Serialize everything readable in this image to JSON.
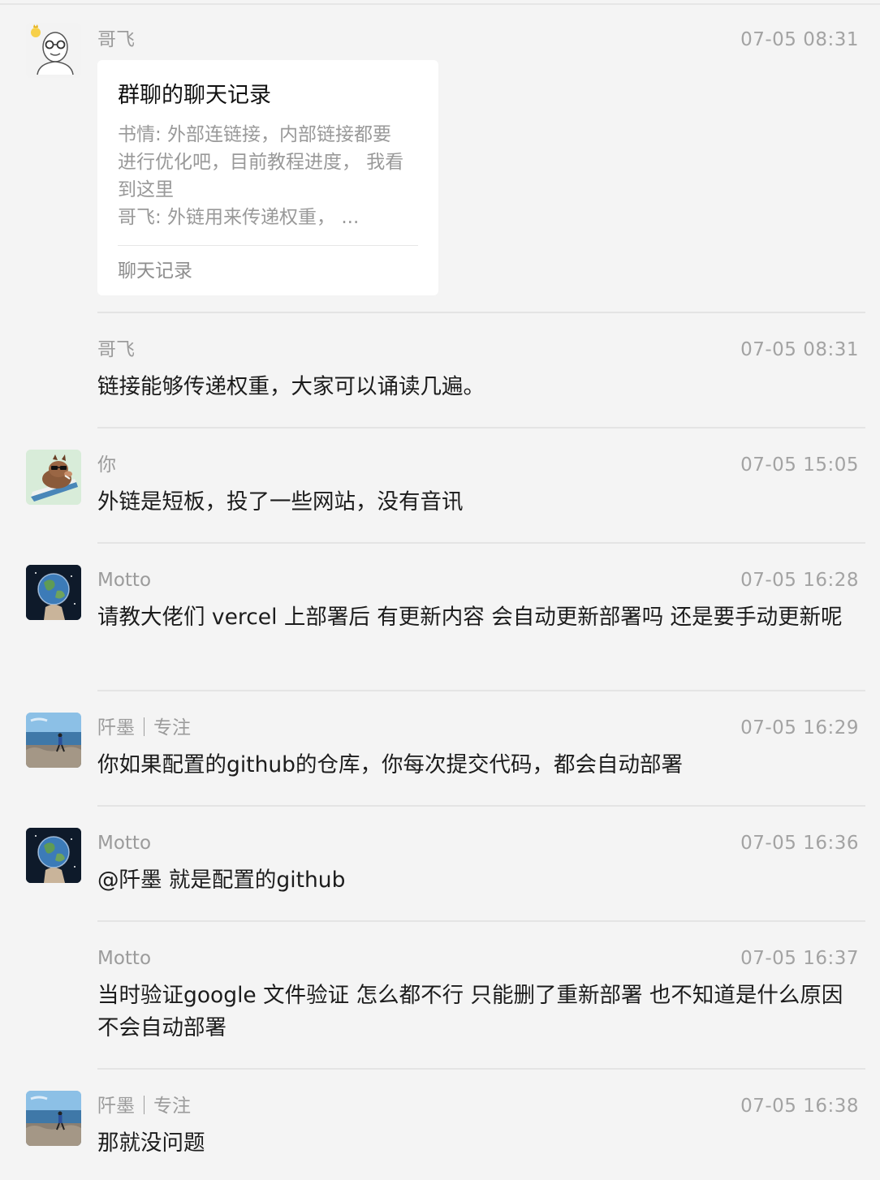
{
  "messages": [
    {
      "sender": "哥飞",
      "time": "07-05 08:31",
      "avatar": "bald-glasses-cartoon",
      "chat_record_card": {
        "title": "群聊的聊天记录",
        "preview_lines": [
          "书情:  外部连链接，内部链接都要",
          "进行优化吧，目前教程进度，  我看",
          "到这里",
          "哥飞: 外链用来传递权重，  ..."
        ],
        "footer": "聊天记录"
      }
    },
    {
      "sender": "哥飞",
      "time": "07-05 08:31",
      "text": "链接能够传递权重，大家可以诵读几遍。"
    },
    {
      "sender": "你",
      "time": "07-05 15:05",
      "avatar": "boar-sunglasses-cartoon",
      "text": "外链是短板，投了一些网站，没有音讯"
    },
    {
      "sender": "Motto",
      "time": "07-05 16:28",
      "avatar": "earth-in-hand",
      "text": "请教大佬们 vercel 上部署后 有更新内容 会自动更新部署吗 还是要手动更新呢"
    },
    {
      "sender": "阡墨｜专注",
      "time": "07-05 16:29",
      "avatar": "person-on-rocks-by-sea",
      "text": "你如果配置的github的仓库，你每次提交代码，都会自动部署"
    },
    {
      "sender": "Motto",
      "time": "07-05 16:36",
      "avatar": "earth-in-hand",
      "text": "@阡墨 就是配置的github"
    },
    {
      "sender": "Motto",
      "time": "07-05 16:37",
      "text": "当时验证google 文件验证 怎么都不行 只能删了重新部署 也不知道是什么原因不会自动部署"
    },
    {
      "sender": "阡墨｜专注",
      "time": "07-05 16:38",
      "avatar": "person-on-rocks-by-sea",
      "text": "那就没问题"
    }
  ]
}
